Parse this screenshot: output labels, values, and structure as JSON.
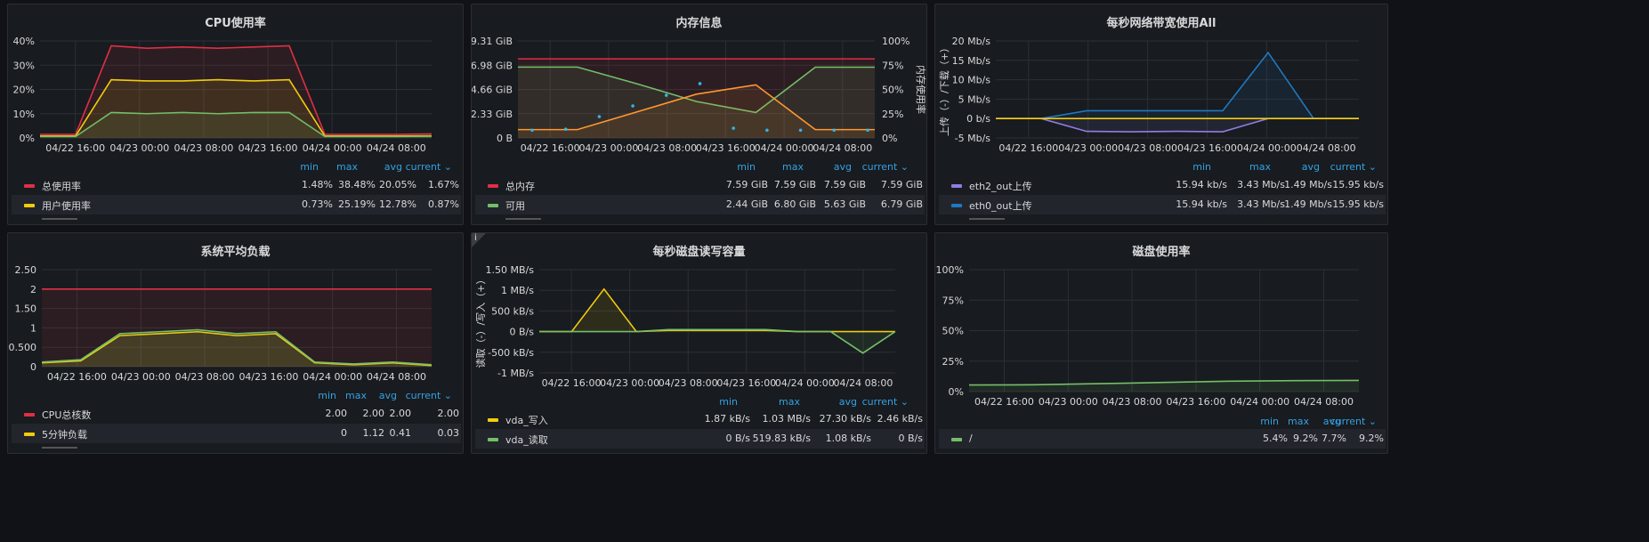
{
  "panels": [
    {
      "title": "CPU使用率",
      "legend_header": [
        "min",
        "max",
        "avg",
        "current ⌄"
      ],
      "legend": [
        {
          "name": "总使用率",
          "color": "#e02f44",
          "values": [
            "1.48%",
            "38.48%",
            "20.05%",
            "1.67%"
          ]
        },
        {
          "name": "用户使用率",
          "color": "#f2cc0c",
          "values": [
            "0.73%",
            "25.19%",
            "12.78%",
            "0.87%"
          ]
        }
      ]
    },
    {
      "title": "内存信息",
      "legend_header": [
        "min",
        "max",
        "avg",
        "current ⌄"
      ],
      "legend": [
        {
          "name": "总内存",
          "color": "#e02f44",
          "values": [
            "7.59 GiB",
            "7.59 GiB",
            "7.59 GiB",
            "7.59 GiB"
          ]
        },
        {
          "name": "可用",
          "color": "#73bf69",
          "values": [
            "2.44 GiB",
            "6.80 GiB",
            "5.63 GiB",
            "6.79 GiB"
          ]
        }
      ]
    },
    {
      "title": "每秒网络带宽使用All",
      "legend_header": [
        "min",
        "max",
        "avg",
        "current ⌄"
      ],
      "legend": [
        {
          "name": "eth2_out上传",
          "color": "#8f7ee0",
          "values": [
            "15.94 kb/s",
            "3.43 Mb/s",
            "1.49 Mb/s",
            "15.95 kb/s"
          ]
        },
        {
          "name": "eth0_out上传",
          "color": "#1f78c1",
          "values": [
            "15.94 kb/s",
            "3.43 Mb/s",
            "1.49 Mb/s",
            "15.95 kb/s"
          ]
        }
      ]
    },
    {
      "title": "系统平均负载",
      "legend_header": [
        "min",
        "max",
        "avg",
        "current ⌄"
      ],
      "legend": [
        {
          "name": "CPU总核数",
          "color": "#e02f44",
          "values": [
            "2.00",
            "2.00",
            "2.00",
            "2.00"
          ]
        },
        {
          "name": "5分钟负载",
          "color": "#f2cc0c",
          "values": [
            "0",
            "1.12",
            "0.41",
            "0.03"
          ]
        }
      ]
    },
    {
      "title": "每秒磁盘读写容量",
      "info_icon": "i",
      "legend_header": [
        "min",
        "max",
        "avg",
        "current ⌄"
      ],
      "legend": [
        {
          "name": "vda_写入",
          "color": "#f2cc0c",
          "values": [
            "1.87 kB/s",
            "1.03 MB/s",
            "27.30 kB/s",
            "2.46 kB/s"
          ]
        },
        {
          "name": "vda_读取",
          "color": "#73bf69",
          "values": [
            "0 B/s",
            "519.83 kB/s",
            "1.08 kB/s",
            "0 B/s"
          ]
        }
      ]
    },
    {
      "title": "磁盘使用率",
      "legend_header": [
        "min",
        "max",
        "avg",
        "current ⌄"
      ],
      "legend": [
        {
          "name": "/",
          "color": "#73bf69",
          "values": [
            "5.4%",
            "9.2%",
            "7.7%",
            "9.2%"
          ]
        }
      ]
    }
  ],
  "chart_data": [
    {
      "type": "line",
      "title": "CPU使用率",
      "yticks": [
        "40%",
        "30%",
        "20%",
        "10%",
        "0%"
      ],
      "ylim": [
        0,
        40
      ],
      "xticks": [
        "04/22 16:00",
        "04/23 00:00",
        "04/23 08:00",
        "04/23 16:00",
        "04/24 00:00",
        "04/24 08:00"
      ],
      "series": [
        {
          "name": "总使用率",
          "color": "#e02f44",
          "values": [
            1.5,
            1.5,
            38,
            37,
            37.5,
            37,
            37.5,
            38,
            1.5,
            1.5,
            1.5,
            1.7
          ]
        },
        {
          "name": "用户使用率",
          "color": "#f2cc0c",
          "values": [
            0.8,
            0.8,
            24,
            23.5,
            23.5,
            24,
            23.5,
            24,
            0.8,
            0.8,
            0.8,
            0.9
          ]
        },
        {
          "color": "#73bf69",
          "values": [
            0.6,
            0.6,
            10.5,
            10,
            10.5,
            10,
            10.5,
            10.5,
            0.6,
            0.6,
            0.6,
            0.7
          ]
        }
      ],
      "grid": true
    },
    {
      "type": "line",
      "title": "内存信息",
      "yticks": [
        "9.31 GiB",
        "6.98 GiB",
        "4.66 GiB",
        "2.33 GiB",
        "0 B"
      ],
      "ylim": [
        0,
        9.31
      ],
      "yticks_right": [
        "100%",
        "75%",
        "50%",
        "25%",
        "0%"
      ],
      "ylabel_right": "内存使用率",
      "xticks": [
        "04/22 16:00",
        "04/23 00:00",
        "04/23 08:00",
        "04/23 16:00",
        "04/24 00:00",
        "04/24 08:00"
      ],
      "series": [
        {
          "name": "总内存",
          "color": "#e02f44",
          "values": [
            7.59,
            7.59,
            7.59,
            7.59,
            7.59,
            7.59
          ]
        },
        {
          "name": "可用",
          "color": "#73bf69",
          "values": [
            6.8,
            6.8,
            5.2,
            3.5,
            2.44,
            6.79,
            6.79
          ]
        },
        {
          "color": "#ff9830",
          "values": [
            0.8,
            0.8,
            2.5,
            4.2,
            5.1,
            0.8,
            0.8
          ]
        }
      ],
      "points": [
        8,
        9,
        22,
        33,
        44,
        56,
        10,
        8,
        8,
        8,
        8
      ],
      "grid": true
    },
    {
      "type": "line",
      "title": "每秒网络带宽使用All",
      "yticks": [
        "20 Mb/s",
        "15 Mb/s",
        "10 Mb/s",
        "5 Mb/s",
        "0 b/s",
        "-5 Mb/s"
      ],
      "ylim": [
        -5,
        20
      ],
      "ylabel": "上传（-）/下载（+）",
      "xticks": [
        "04/22 16:00",
        "04/23 00:00",
        "04/23 08:00",
        "04/23 16:00",
        "04/24 00:00",
        "04/24 08:00"
      ],
      "series": [
        {
          "name": "eth2_out上传",
          "color": "#8f7ee0",
          "values": [
            0,
            0,
            -3.3,
            -3.4,
            -3.3,
            -3.4,
            0,
            0,
            0
          ]
        },
        {
          "name": "eth0_out上传",
          "color": "#1f78c1",
          "values": [
            0,
            0,
            2,
            2,
            2,
            2,
            17,
            0,
            0
          ]
        },
        {
          "color": "#f2cc0c",
          "values": [
            0,
            0,
            0,
            0,
            0,
            0,
            0,
            0,
            0
          ]
        }
      ],
      "grid": true
    },
    {
      "type": "line",
      "title": "系统平均负载",
      "yticks": [
        "2.50",
        "2",
        "1.50",
        "1",
        "0.500",
        "0"
      ],
      "ylim": [
        0,
        2.5
      ],
      "xticks": [
        "04/22 16:00",
        "04/23 00:00",
        "04/23 08:00",
        "04/23 16:00",
        "04/24 00:00",
        "04/24 08:00"
      ],
      "series": [
        {
          "name": "CPU总核数",
          "color": "#e02f44",
          "values": [
            2,
            2,
            2,
            2,
            2,
            2
          ]
        },
        {
          "name": "5分钟负载",
          "color": "#f2cc0c",
          "values": [
            0.1,
            0.15,
            0.8,
            0.85,
            0.9,
            0.8,
            0.85,
            0.1,
            0.05,
            0.1,
            0.03
          ]
        },
        {
          "color": "#73bf69",
          "values": [
            0.12,
            0.18,
            0.85,
            0.9,
            0.95,
            0.85,
            0.9,
            0.12,
            0.07,
            0.12,
            0.05
          ]
        }
      ],
      "grid": true
    },
    {
      "type": "line",
      "title": "每秒磁盘读写容量",
      "yticks": [
        "1.50 MB/s",
        "1 MB/s",
        "500 kB/s",
        "0 B/s",
        "-500 kB/s",
        "-1 MB/s"
      ],
      "ylim": [
        -1,
        1.5
      ],
      "ylabel": "读取（-）/写入（+）",
      "xticks": [
        "04/22 16:00",
        "04/23 00:00",
        "04/23 08:00",
        "04/23 16:00",
        "04/24 00:00",
        "04/24 08:00"
      ],
      "series": [
        {
          "name": "vda_写入",
          "color": "#f2cc0c",
          "values": [
            0,
            0,
            1.03,
            0,
            0.03,
            0.03,
            0.03,
            0.03,
            0,
            0,
            0,
            0
          ]
        },
        {
          "name": "vda_读取",
          "color": "#73bf69",
          "values": [
            0,
            0,
            0,
            0,
            0.05,
            0.05,
            0.05,
            0.05,
            0,
            0,
            -0.52,
            0
          ]
        }
      ],
      "grid": true
    },
    {
      "type": "line",
      "title": "磁盘使用率",
      "yticks": [
        "100%",
        "75%",
        "50%",
        "25%",
        "0%"
      ],
      "ylim": [
        0,
        100
      ],
      "xticks": [
        "04/22 16:00",
        "04/23 00:00",
        "04/23 08:00",
        "04/23 16:00",
        "04/24 00:00",
        "04/24 08:00"
      ],
      "series": [
        {
          "name": "/",
          "color": "#73bf69",
          "values": [
            5.4,
            5.6,
            6.5,
            7.5,
            8.5,
            9.0,
            9.2
          ]
        }
      ],
      "grid": true
    }
  ]
}
